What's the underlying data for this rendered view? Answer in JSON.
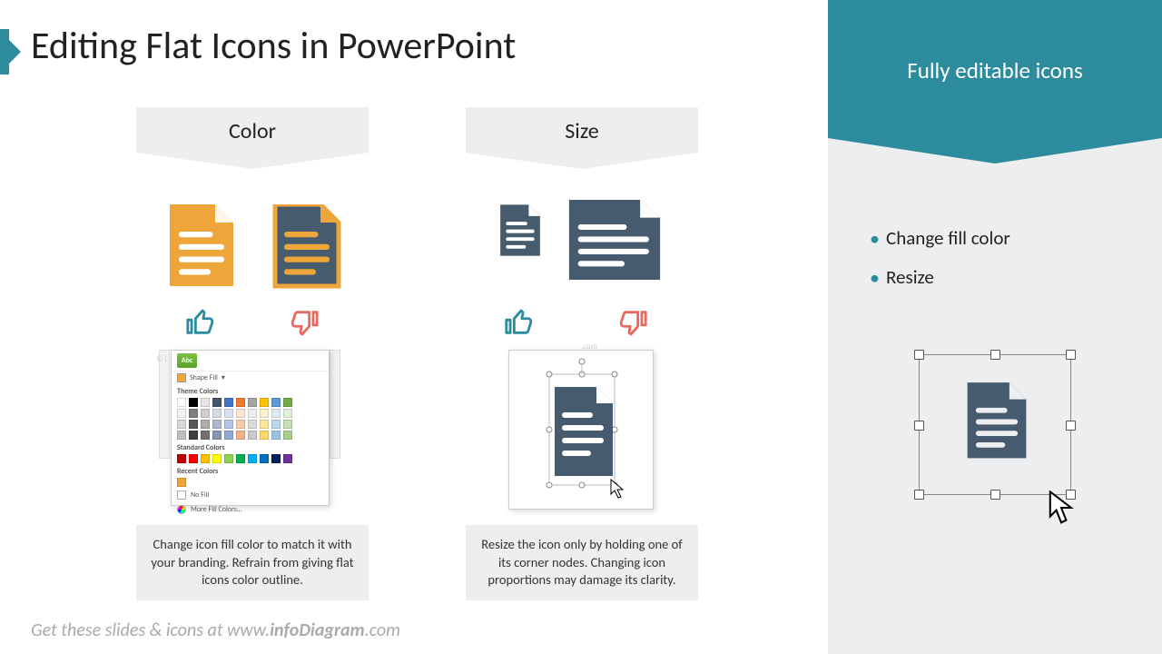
{
  "title": "Editing Flat Icons in PowerPoint",
  "columns": {
    "color": {
      "header": "Color",
      "description": "Change icon fill color to match it with your branding. Refrain from giving flat icons color outline."
    },
    "size": {
      "header": "Size",
      "description": "Resize the icon only by holding one of its corner nodes. Changing icon proportions may damage its clarity."
    }
  },
  "sidebar": {
    "title": "Fully editable icons",
    "bullets": [
      "Change fill color",
      "Resize"
    ]
  },
  "shapefill": {
    "label": "Shape Fill",
    "theme": "Theme Colors",
    "standard": "Standard Colors",
    "recent": "Recent Colors",
    "nofill": "No Fill",
    "more": "More Fill Colors…",
    "abc": "Abc"
  },
  "footer_prefix": "Get these slides & icons at www.",
  "footer_bold": "infoDiagram",
  "footer_suffix": ".com",
  "colors": {
    "teal": "#2c8b9d",
    "orange": "#eea53a",
    "slate": "#465b6e",
    "red": "#e86a5e"
  }
}
